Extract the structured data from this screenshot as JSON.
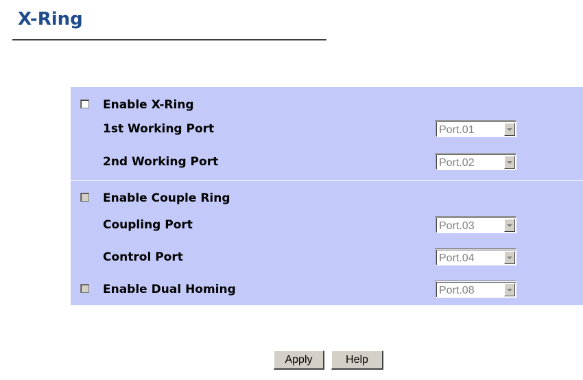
{
  "page": {
    "title": "X-Ring"
  },
  "xring": {
    "enable_label": "Enable X-Ring",
    "enabled": false,
    "first_port_label": "1st Working Port",
    "first_port_value": "Port.01",
    "second_port_label": "2nd Working Port",
    "second_port_value": "Port.02"
  },
  "couple_ring": {
    "enable_label": "Enable Couple Ring",
    "enabled": false,
    "coupling_port_label": "Coupling Port",
    "coupling_port_value": "Port.03",
    "control_port_label": "Control Port",
    "control_port_value": "Port.04"
  },
  "dual_homing": {
    "enable_label": "Enable Dual Homing",
    "enabled": false,
    "port_value": "Port.08"
  },
  "buttons": {
    "apply": "Apply",
    "help": "Help"
  },
  "colors": {
    "title": "#1f4b8c",
    "panel": "#c3c9f8",
    "button_face": "#d4d0c8"
  }
}
